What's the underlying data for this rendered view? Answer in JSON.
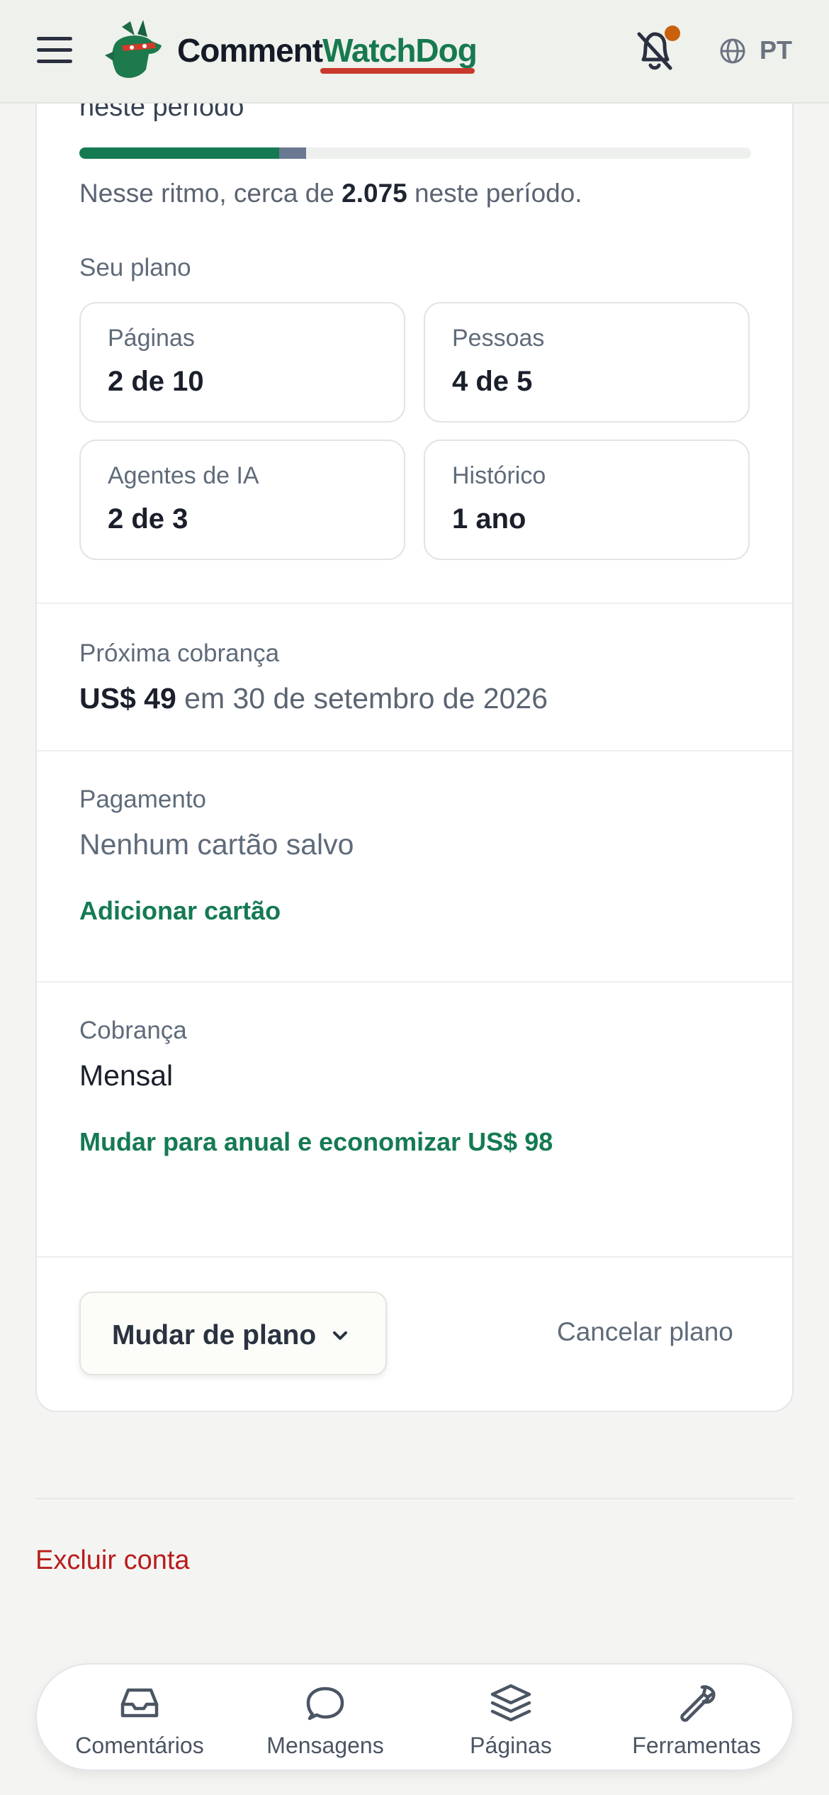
{
  "header": {
    "brand_part1": "Comment",
    "brand_part2": "WatchDog",
    "language": "PT",
    "icons": [
      "menu-icon",
      "watchdog-logo",
      "bell-off-icon",
      "globe-icon"
    ],
    "colors": {
      "brand_green": "#17794f",
      "underline_red": "#c9392b",
      "notification_dot": "#c8600c"
    }
  },
  "usage": {
    "fragment_text": "neste período",
    "progress_used": 0.297,
    "progress_projected": 0.338,
    "pace_prefix": "Nesse ritmo, cerca de ",
    "pace_number": "2.075",
    "pace_suffix": " neste período."
  },
  "plan": {
    "label": "Seu plano",
    "tiles": [
      {
        "label": "Páginas",
        "value": "2 de 10"
      },
      {
        "label": "Pessoas",
        "value": "4 de 5"
      },
      {
        "label": "Agentes de IA",
        "value": "2 de 3"
      },
      {
        "label": "Histórico",
        "value": "1 ano"
      }
    ]
  },
  "next_charge": {
    "label": "Próxima cobrança",
    "amount": "US$ 49",
    "date_text": " em 30 de setembro de 2026"
  },
  "payment": {
    "label": "Pagamento",
    "value": "Nenhum cartão salvo",
    "add_card": "Adicionar cartão"
  },
  "billing": {
    "label": "Cobrança",
    "value": "Mensal",
    "switch_annual": "Mudar para anual e economizar US$ 98"
  },
  "actions": {
    "change_plan": "Mudar de plano",
    "cancel_plan": "Cancelar plano"
  },
  "danger": {
    "delete_account": "Excluir conta"
  },
  "bottom_nav": [
    {
      "label": "Comentários",
      "icon": "inbox-icon"
    },
    {
      "label": "Mensagens",
      "icon": "chat-bubble-icon"
    },
    {
      "label": "Páginas",
      "icon": "layers-icon"
    },
    {
      "label": "Ferramentas",
      "icon": "wrench-icon"
    }
  ]
}
